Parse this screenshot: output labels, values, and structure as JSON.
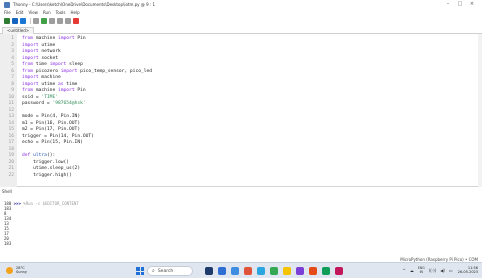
{
  "window": {
    "title": "Thonny - C:\\Users\\ketch\\OneDrive\\Documents\\Desktop\\iotm.py @ 9 : 1",
    "minimize_glyph": "–",
    "maximize_glyph": "□",
    "close_glyph": "×"
  },
  "menu": [
    "File",
    "Edit",
    "View",
    "Run",
    "Tools",
    "Help"
  ],
  "toolbar": {
    "colors": [
      "#2e7d32",
      "#1565c0",
      "#1976d2",
      "#9e9e9e",
      "#43a047",
      "#9e9e9e",
      "#9e9e9e",
      "#9e9e9e",
      "#e53935",
      "#fbc02d"
    ]
  },
  "tab": {
    "label": "<untitled>"
  },
  "editor": {
    "lines": [
      {
        "n": "1",
        "segs": [
          {
            "t": "from",
            "c": "kw"
          },
          {
            "t": " machine "
          },
          {
            "t": "import",
            "c": "kw"
          },
          {
            "t": " Pin"
          }
        ]
      },
      {
        "n": "2",
        "segs": [
          {
            "t": "import",
            "c": "kw"
          },
          {
            "t": " utime"
          }
        ]
      },
      {
        "n": "3",
        "segs": [
          {
            "t": "import",
            "c": "kw"
          },
          {
            "t": " network"
          }
        ]
      },
      {
        "n": "4",
        "segs": [
          {
            "t": "import",
            "c": "kw"
          },
          {
            "t": " socket"
          }
        ]
      },
      {
        "n": "5",
        "segs": [
          {
            "t": "from",
            "c": "kw"
          },
          {
            "t": " time "
          },
          {
            "t": "import",
            "c": "kw"
          },
          {
            "t": " sleep"
          }
        ]
      },
      {
        "n": "6",
        "segs": [
          {
            "t": "from",
            "c": "kw"
          },
          {
            "t": " picozero "
          },
          {
            "t": "import",
            "c": "kw"
          },
          {
            "t": " pico_temp_sensor, pico_led"
          }
        ]
      },
      {
        "n": "7",
        "segs": [
          {
            "t": "import",
            "c": "kw"
          },
          {
            "t": " machine"
          }
        ]
      },
      {
        "n": "8",
        "segs": [
          {
            "t": "import",
            "c": "kw"
          },
          {
            "t": " utime "
          },
          {
            "t": "as",
            "c": "kw"
          },
          {
            "t": " time"
          }
        ]
      },
      {
        "n": "9",
        "segs": [
          {
            "t": "from",
            "c": "kw"
          },
          {
            "t": " machine "
          },
          {
            "t": "import",
            "c": "kw"
          },
          {
            "t": " Pin"
          }
        ]
      },
      {
        "n": "10",
        "segs": [
          {
            "t": "ssid = "
          },
          {
            "t": "'TIME'",
            "c": "str"
          }
        ]
      },
      {
        "n": "11",
        "segs": [
          {
            "t": "password = "
          },
          {
            "t": "'987654@hsk'",
            "c": "str"
          }
        ]
      },
      {
        "n": "12",
        "segs": []
      },
      {
        "n": "13",
        "segs": [
          {
            "t": "mode = Pin(4, Pin.IN)"
          }
        ]
      },
      {
        "n": "14",
        "segs": [
          {
            "t": "m1 = Pin(16, Pin.OUT)"
          }
        ]
      },
      {
        "n": "15",
        "segs": [
          {
            "t": "m2 = Pin(17, Pin.OUT)"
          }
        ]
      },
      {
        "n": "16",
        "segs": [
          {
            "t": "trigger = Pin(14, Pin.OUT)"
          }
        ]
      },
      {
        "n": "17",
        "segs": [
          {
            "t": "echo = Pin(15, Pin.IN)"
          }
        ]
      },
      {
        "n": "18",
        "segs": []
      },
      {
        "n": "19",
        "segs": [
          {
            "t": "def",
            "c": "kw"
          },
          {
            "t": " "
          },
          {
            "t": "ultra",
            "c": "fn"
          },
          {
            "t": "():"
          }
        ]
      },
      {
        "n": "20",
        "segs": [
          {
            "t": "    trigger.low()"
          }
        ]
      },
      {
        "n": "21",
        "segs": [
          {
            "t": "    utime.sleep_us(2)"
          }
        ]
      },
      {
        "n": "22",
        "segs": [
          {
            "t": "    trigger.high()"
          }
        ]
      }
    ]
  },
  "shell": {
    "header": "Shell",
    "prompt": ">>>",
    "command": " %Run -c $EDITOR_CONTENT",
    "output": [
      "180",
      "183",
      "8",
      "134",
      "13",
      "15",
      "17",
      "20",
      "183"
    ]
  },
  "status": {
    "interpreter": "MicroPython (Raspberry Pi Pico) • COM"
  },
  "taskbar": {
    "weather_temp": "28°C",
    "weather_desc": "Sunny",
    "search_glyph": "⌕",
    "search_label": "Search",
    "app_colors": [
      "#1e3a6b",
      "#2f6fd3",
      "#3d8ee0",
      "#e0533b",
      "#2aa5e0",
      "#34a853",
      "#f5c400",
      "#7a3fd6",
      "#e64a19",
      "#0f9d58",
      "#c2185b"
    ],
    "tray_chevron": "^",
    "tray_cloud": "☁",
    "tray_lang": "ENG\nIN",
    "tray_wifi": "((·))",
    "tray_speaker": "◀)",
    "tray_battery": "▭",
    "clock_time": "11:56",
    "clock_date": "26-05-2023"
  }
}
